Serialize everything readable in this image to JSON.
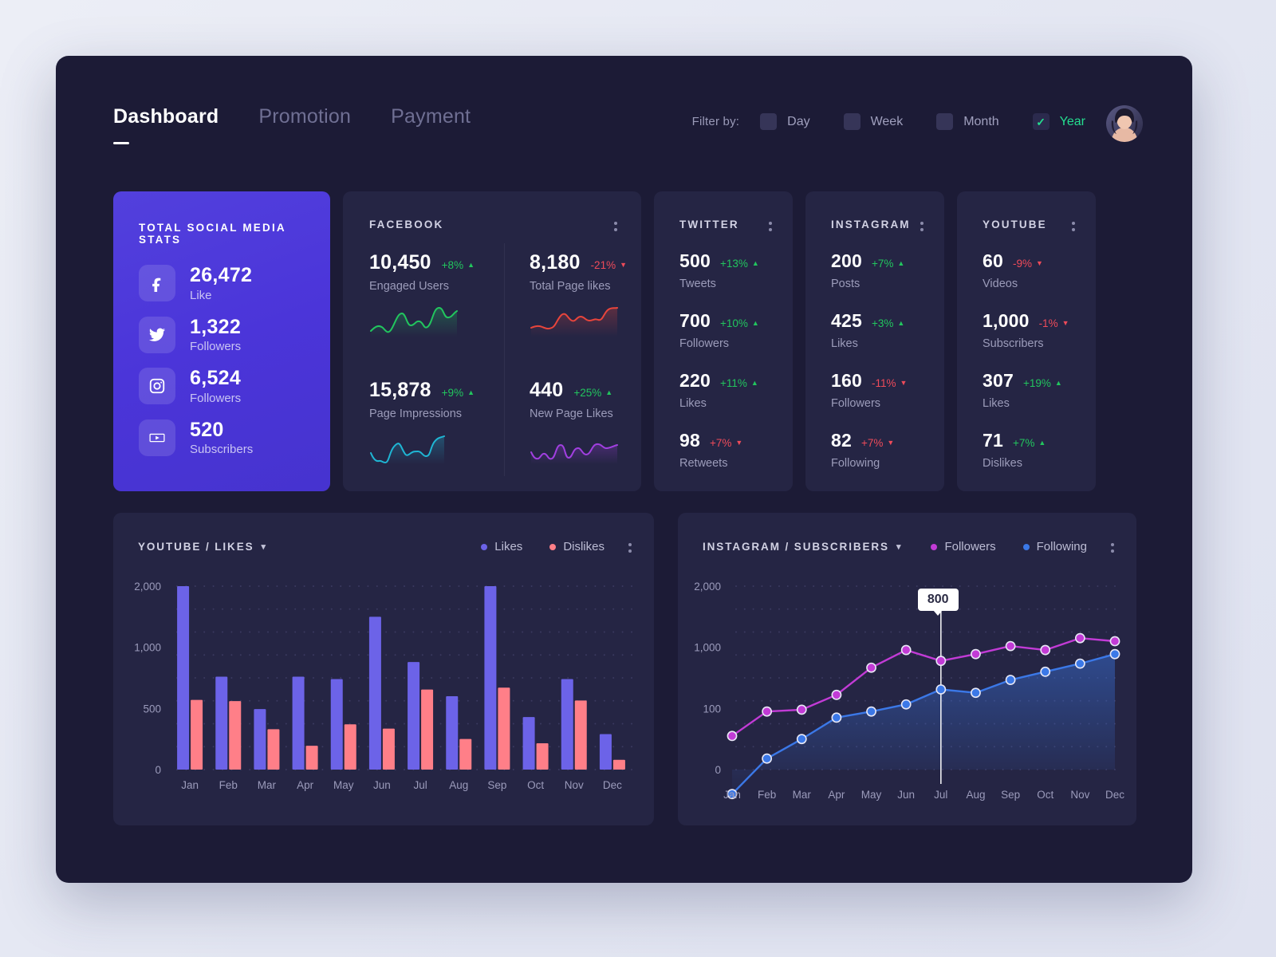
{
  "nav": {
    "tabs": [
      {
        "label": "Dashboard",
        "active": true
      },
      {
        "label": "Promotion",
        "active": false
      },
      {
        "label": "Payment",
        "active": false
      }
    ]
  },
  "filter": {
    "label": "Filter by:",
    "options": [
      {
        "label": "Day",
        "checked": false
      },
      {
        "label": "Week",
        "checked": false
      },
      {
        "label": "Month",
        "checked": false
      },
      {
        "label": "Year",
        "checked": true
      }
    ],
    "check_glyph": "✓",
    "active_color": "#24dd8f"
  },
  "total_card": {
    "title": "TOTAL SOCIAL MEDIA STATS",
    "accent": "#4d37d8",
    "items": [
      {
        "icon": "facebook-icon",
        "value": "26,472",
        "label": "Like"
      },
      {
        "icon": "twitter-icon",
        "value": "1,322",
        "label": "Followers"
      },
      {
        "icon": "instagram-icon",
        "value": "6,524",
        "label": "Followers"
      },
      {
        "icon": "youtube-icon",
        "value": "520",
        "label": "Subscribers"
      }
    ]
  },
  "facebook_card": {
    "title": "FACEBOOK",
    "metrics": [
      {
        "value": "10,450",
        "delta": "+8%",
        "dir": "up",
        "label": "Engaged Users",
        "spark_color": "#22c55e"
      },
      {
        "value": "8,180",
        "delta": "-21%",
        "dir": "down",
        "label": "Total Page likes",
        "spark_color": "#e8453c"
      },
      {
        "value": "15,878",
        "delta": "+9%",
        "dir": "up",
        "label": "Page Impressions",
        "spark_color": "#1fb6d4"
      },
      {
        "value": "440",
        "delta": "+25%",
        "dir": "up",
        "label": "New Page Likes",
        "spark_color": "#a13fe0"
      }
    ]
  },
  "mini_cards": [
    {
      "title": "TWITTER",
      "metrics": [
        {
          "value": "500",
          "delta": "+13%",
          "dir": "up",
          "label": "Tweets"
        },
        {
          "value": "700",
          "delta": "+10%",
          "dir": "up",
          "label": "Followers"
        },
        {
          "value": "220",
          "delta": "+11%",
          "dir": "up",
          "label": "Likes"
        },
        {
          "value": "98",
          "delta": "+7%",
          "dir": "down",
          "label": "Retweets"
        }
      ]
    },
    {
      "title": "INSTAGRAM",
      "metrics": [
        {
          "value": "200",
          "delta": "+7%",
          "dir": "up",
          "label": "Posts"
        },
        {
          "value": "425",
          "delta": "+3%",
          "dir": "up",
          "label": "Likes"
        },
        {
          "value": "160",
          "delta": "-11%",
          "dir": "down",
          "label": "Followers"
        },
        {
          "value": "82",
          "delta": "+7%",
          "dir": "down",
          "label": "Following"
        }
      ]
    },
    {
      "title": "YOUTUBE",
      "metrics": [
        {
          "value": "60",
          "delta": "-9%",
          "dir": "down",
          "label": "Videos"
        },
        {
          "value": "1,000",
          "delta": "-1%",
          "dir": "down",
          "label": "Subscribers"
        },
        {
          "value": "307",
          "delta": "+19%",
          "dir": "up",
          "label": "Likes"
        },
        {
          "value": "71",
          "delta": "+7%",
          "dir": "up",
          "label": "Dislikes"
        }
      ]
    }
  ],
  "bar_chart_card": {
    "title": "YOUTUBE / LIKES",
    "chevron": "▾",
    "legend": [
      {
        "label": "Likes",
        "color": "#6c63e8"
      },
      {
        "label": "Dislikes",
        "color": "#ff7f88"
      }
    ]
  },
  "line_chart_card": {
    "title": "INSTAGRAM / SUBSCRIBERS",
    "chevron": "▾",
    "legend": [
      {
        "label": "Followers",
        "color": "#c23bd6"
      },
      {
        "label": "Following",
        "color": "#3b78e7"
      }
    ],
    "tooltip": "800"
  },
  "chart_data": [
    {
      "type": "bar",
      "title": "YOUTUBE / LIKES",
      "categories": [
        "Jan",
        "Feb",
        "Mar",
        "Apr",
        "May",
        "Jun",
        "Jul",
        "Aug",
        "Sep",
        "Oct",
        "Nov",
        "Dec"
      ],
      "series": [
        {
          "name": "Likes",
          "color": "#6c63e8",
          "values": [
            2000,
            760,
            495,
            760,
            740,
            1500,
            880,
            600,
            2000,
            430,
            740,
            290
          ]
        },
        {
          "name": "Dislikes",
          "color": "#ff7f88",
          "values": [
            570,
            560,
            330,
            195,
            370,
            335,
            655,
            250,
            670,
            215,
            565,
            80
          ]
        }
      ],
      "ytick_labels": [
        "0",
        "500",
        "1,000",
        "2,000"
      ],
      "ytick_values": [
        0,
        500,
        1000,
        2000
      ],
      "ylim": [
        0,
        2000
      ],
      "xlabel": "",
      "ylabel": "",
      "grid": "dotted",
      "legend_position": "top-right"
    },
    {
      "type": "line",
      "title": "INSTAGRAM / SUBSCRIBERS",
      "categories": [
        "Jan",
        "Feb",
        "Mar",
        "Apr",
        "May",
        "Jun",
        "Jul",
        "Aug",
        "Sep",
        "Oct",
        "Nov",
        "Dec"
      ],
      "series": [
        {
          "name": "Followers",
          "color": "#c23bd6",
          "values": [
            55,
            95,
            98,
            300,
            700,
            960,
            800,
            900,
            1020,
            960,
            1150,
            1100
          ]
        },
        {
          "name": "Following",
          "color": "#3b78e7",
          "values": [
            -40,
            18,
            50,
            85,
            95,
            160,
            380,
            330,
            520,
            640,
            760,
            900
          ]
        }
      ],
      "ytick_labels": [
        "0",
        "100",
        "1,000",
        "2,000"
      ],
      "ytick_values": [
        0,
        100,
        1000,
        2000
      ],
      "ylim": [
        0,
        2000
      ],
      "annotation": {
        "label": "800",
        "at_category": "Jul"
      },
      "area_fill": true,
      "grid": "dotted",
      "legend_position": "top-right"
    }
  ]
}
